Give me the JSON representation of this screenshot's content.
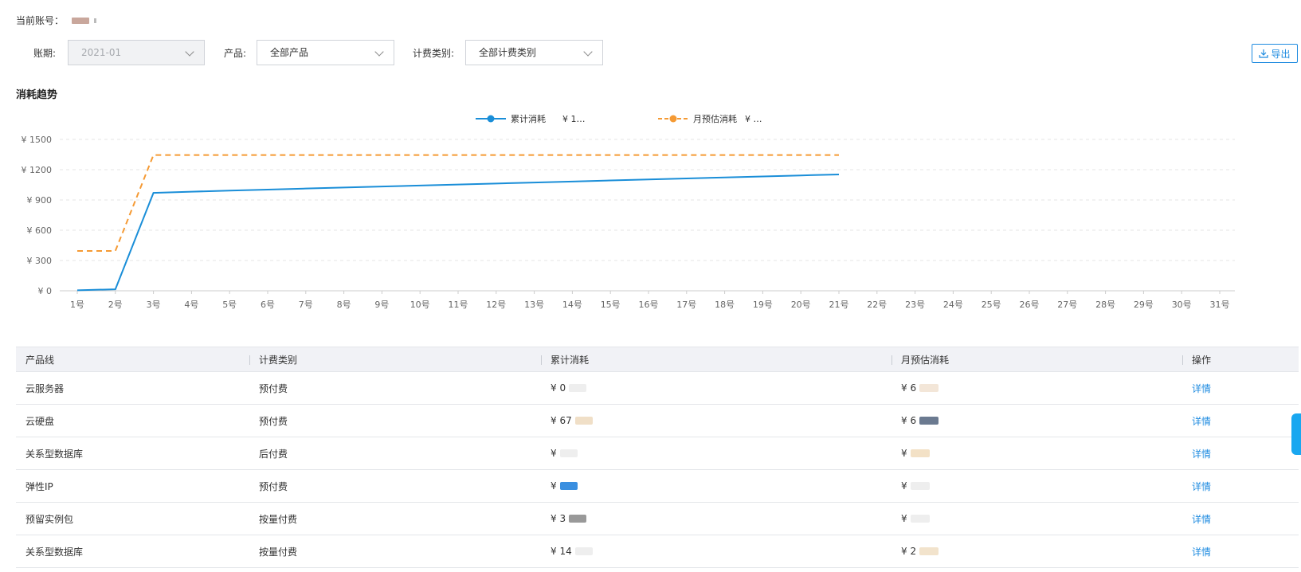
{
  "account": {
    "label": "当前账号："
  },
  "filters": {
    "period_label": "账期:",
    "period_value": "2021-01",
    "product_label": "产品:",
    "product_value": "全部产品",
    "billing_label": "计费类别:",
    "billing_value": "全部计费类别"
  },
  "toolbar": {
    "export_label": "导出"
  },
  "section": {
    "title": "消耗趋势"
  },
  "colors": {
    "accent": "#1e8be0",
    "series_cumulative": "#1a8ed8",
    "series_estimate": "#f59a34",
    "header_bg": "#f1f2f6"
  },
  "chart_data": {
    "type": "line",
    "x": [
      "1号",
      "2号",
      "3号",
      "4号",
      "5号",
      "6号",
      "7号",
      "8号",
      "9号",
      "10号",
      "11号",
      "12号",
      "13号",
      "14号",
      "15号",
      "16号",
      "17号",
      "18号",
      "19号",
      "20号",
      "21号",
      "22号",
      "23号",
      "24号",
      "25号",
      "26号",
      "27号",
      "28号",
      "29号",
      "30号",
      "31号"
    ],
    "yticks": [
      "¥ 0",
      "¥ 300",
      "¥ 600",
      "¥ 900",
      "¥ 1200",
      "¥ 1500"
    ],
    "ylim": [
      0,
      1500
    ],
    "grid": true,
    "legend_position": "top-center",
    "series": [
      {
        "name": "累计消耗",
        "legend_value": "¥ 1…",
        "style": "solid",
        "values": [
          5,
          15,
          970,
          982,
          993,
          1003,
          1013,
          1023,
          1033,
          1043,
          1053,
          1063,
          1073,
          1083,
          1093,
          1103,
          1113,
          1123,
          1133,
          1143,
          1153
        ]
      },
      {
        "name": "月预估消耗",
        "legend_value": "¥ …",
        "style": "dashed",
        "values": [
          395,
          395,
          1345,
          1345,
          1345,
          1345,
          1345,
          1345,
          1345,
          1345,
          1345,
          1345,
          1345,
          1345,
          1345,
          1345,
          1345,
          1345,
          1345,
          1345,
          1345
        ]
      }
    ]
  },
  "table": {
    "headers": [
      "产品线",
      "计费类别",
      "累计消耗",
      "月预估消耗",
      "操作"
    ],
    "rows": [
      {
        "product": "云服务器",
        "billing": "预付费",
        "cumulative": "¥ 0",
        "estimate": "¥ 6",
        "action": "详情"
      },
      {
        "product": "云硬盘",
        "billing": "预付费",
        "cumulative": "¥ 67",
        "estimate": "¥ 6",
        "action": "详情"
      },
      {
        "product": "关系型数据库",
        "billing": "后付费",
        "cumulative": "¥",
        "estimate": "¥",
        "action": "详情"
      },
      {
        "product": "弹性IP",
        "billing": "预付费",
        "cumulative": "¥",
        "estimate": "¥",
        "action": "详情"
      },
      {
        "product": "预留实例包",
        "billing": "按量付费",
        "cumulative": "¥ 3",
        "estimate": "¥",
        "action": "详情"
      },
      {
        "product": "关系型数据库",
        "billing": "按量付费",
        "cumulative": "¥ 14",
        "estimate": "¥ 2",
        "action": "详情"
      }
    ]
  }
}
